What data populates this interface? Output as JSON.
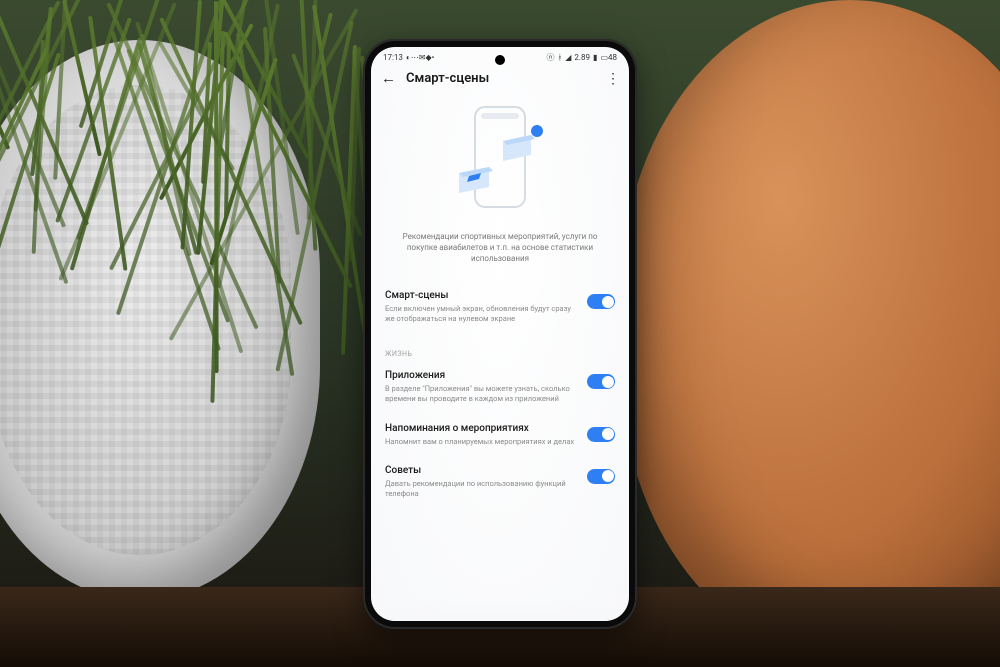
{
  "statusbar": {
    "time": "17:13",
    "network_label": "2.89",
    "battery_label": "48"
  },
  "appbar": {
    "title": "Смарт-сцены"
  },
  "caption": "Рекомендации спортивных мероприятий, услуги по покупке авиабилетов и т.п. на основе статистики использования",
  "settings_main": {
    "label": "Смарт-сцены",
    "desc": "Если включен умный экран, обновления будут сразу же отображаться на нулевом экране"
  },
  "section_header": "ЖИЗНЬ",
  "settings": [
    {
      "label": "Приложения",
      "desc": "В разделе \"Приложения\" вы можете узнать, сколько времени вы проводите в каждом из приложений"
    },
    {
      "label": "Напоминания о мероприятиях",
      "desc": "Напомнит вам о планируемых мероприятиях и делах"
    },
    {
      "label": "Советы",
      "desc": "Давать рекомендации по использованию функций телефона"
    }
  ],
  "colors": {
    "accent": "#2f7ff4"
  }
}
